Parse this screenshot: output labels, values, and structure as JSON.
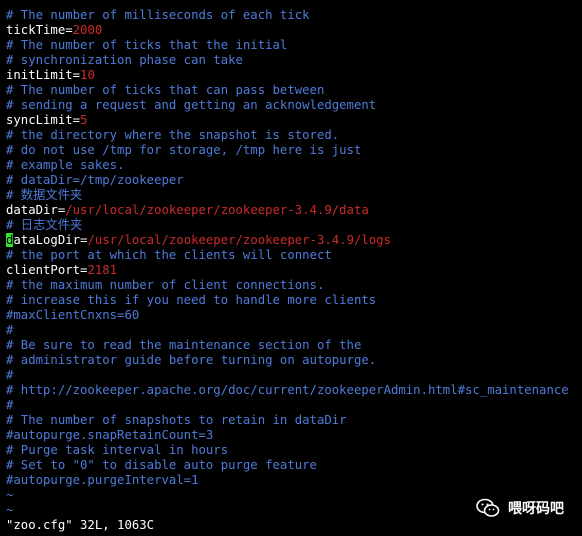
{
  "file": {
    "lines": [
      {
        "type": "comment",
        "text": "# The number of milliseconds of each tick"
      },
      {
        "type": "kv",
        "key": "tickTime=",
        "value": "2000"
      },
      {
        "type": "comment",
        "text": "# The number of ticks that the initial"
      },
      {
        "type": "comment",
        "text": "# synchronization phase can take"
      },
      {
        "type": "kv",
        "key": "initLimit=",
        "value": "10"
      },
      {
        "type": "comment",
        "text": "# The number of ticks that can pass between"
      },
      {
        "type": "comment",
        "text": "# sending a request and getting an acknowledgement"
      },
      {
        "type": "kv",
        "key": "syncLimit=",
        "value": "5"
      },
      {
        "type": "comment",
        "text": "# the directory where the snapshot is stored."
      },
      {
        "type": "comment",
        "text": "# do not use /tmp for storage, /tmp here is just"
      },
      {
        "type": "comment",
        "text": "# example sakes."
      },
      {
        "type": "comment",
        "text": "# dataDir=/tmp/zookeeper"
      },
      {
        "type": "comment",
        "text": "# 数据文件夹"
      },
      {
        "type": "kv",
        "key": "dataDir=",
        "value": "/usr/local/zookeeper/zookeeper-3.4.9/data"
      },
      {
        "type": "comment",
        "text": "# 日志文件夹"
      },
      {
        "type": "kv",
        "key": "dataLogDir=",
        "value": "/usr/local/zookeeper/zookeeper-3.4.9/logs",
        "cursor": true
      },
      {
        "type": "comment",
        "text": "# the port at which the clients will connect"
      },
      {
        "type": "kv",
        "key": "clientPort=",
        "value": "2181"
      },
      {
        "type": "comment",
        "text": "# the maximum number of client connections."
      },
      {
        "type": "comment",
        "text": "# increase this if you need to handle more clients"
      },
      {
        "type": "comment",
        "text": "#maxClientCnxns=60"
      },
      {
        "type": "comment",
        "text": "#"
      },
      {
        "type": "comment",
        "text": "# Be sure to read the maintenance section of the"
      },
      {
        "type": "comment",
        "text": "# administrator guide before turning on autopurge."
      },
      {
        "type": "comment",
        "text": "#"
      },
      {
        "type": "comment",
        "text": "# http://zookeeper.apache.org/doc/current/zookeeperAdmin.html#sc_maintenance"
      },
      {
        "type": "comment",
        "text": "#"
      },
      {
        "type": "comment",
        "text": "# The number of snapshots to retain in dataDir"
      },
      {
        "type": "comment",
        "text": "#autopurge.snapRetainCount=3"
      },
      {
        "type": "comment",
        "text": "# Purge task interval in hours"
      },
      {
        "type": "comment",
        "text": "# Set to \"0\" to disable auto purge feature"
      },
      {
        "type": "comment",
        "text": "#autopurge.purgeInterval=1"
      },
      {
        "type": "tilde",
        "text": "~"
      },
      {
        "type": "tilde",
        "text": "~"
      }
    ]
  },
  "status_line": "\"zoo.cfg\" 32L, 1063C",
  "watermark": {
    "text": "喂呀码吧",
    "icon": "wechat-icon"
  },
  "colors": {
    "background": "#000000",
    "comment": "#4f7bd9",
    "value": "#cc2a2a",
    "cursor": "#2ee62e"
  }
}
